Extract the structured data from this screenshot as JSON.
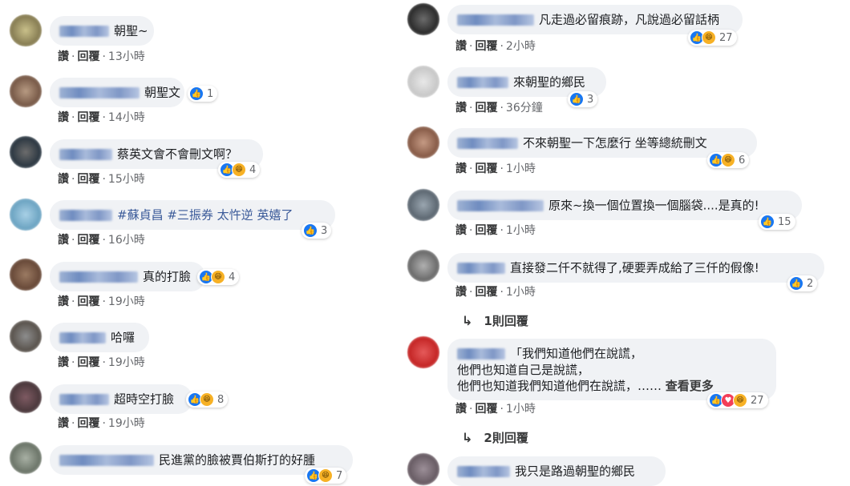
{
  "colors": {
    "like": "#1877f2",
    "haha": "#f7b125",
    "love": "#f33e58",
    "bubble": "#f0f2f5"
  },
  "labels": {
    "like": "讚",
    "reply": "回覆",
    "sep": "·"
  },
  "left_comments": [
    {
      "text": "朝聖~",
      "time": "13小時",
      "reactions": [],
      "count": ""
    },
    {
      "text": "朝聖文",
      "time": "14小時",
      "reactions": [
        "like"
      ],
      "count": "1"
    },
    {
      "text": "蔡英文會不會刪文啊？",
      "time": "15小時",
      "reactions": [
        "like",
        "haha"
      ],
      "count": "4"
    },
    {
      "text": "#蘇貞昌 #三振券 太忤逆 英嬉了",
      "time": "16小時",
      "reactions": [
        "like"
      ],
      "count": "3"
    },
    {
      "text": "真的打臉",
      "time": "19小時",
      "reactions": [
        "like",
        "haha"
      ],
      "count": "4"
    },
    {
      "text": "哈囉",
      "time": "19小時",
      "reactions": [],
      "count": ""
    },
    {
      "text": "超時空打臉",
      "time": "19小時",
      "reactions": [
        "like",
        "haha"
      ],
      "count": "8"
    },
    {
      "text": "民進黨的臉被賈伯斯打的好腫",
      "time": "",
      "reactions": [
        "like",
        "haha"
      ],
      "count": "7"
    }
  ],
  "right_comments": [
    {
      "text": "凡走過必留痕跡，凡說過必留話柄",
      "time": "2小時",
      "reactions": [
        "like",
        "haha"
      ],
      "count": "27"
    },
    {
      "text": "來朝聖的鄉民",
      "time": "36分鐘",
      "reactions": [
        "like"
      ],
      "count": "3"
    },
    {
      "text": "不來朝聖一下怎麼行 坐等總統刪文",
      "time": "1小時",
      "reactions": [
        "like",
        "haha"
      ],
      "count": "6"
    },
    {
      "text": "原來~換一個位置換一個腦袋....是真的!",
      "time": "1小時",
      "reactions": [
        "like"
      ],
      "count": "15"
    },
    {
      "text": "直接發二仟不就得了,硬要弄成給了三仟的假像!",
      "time": "1小時",
      "reactions": [
        "like"
      ],
      "count": "2"
    },
    {
      "text_lines": [
        "「我們知道他們在說謊，",
        "他們也知道自己是說謊，",
        "他們也知道我們知道他們在說謊，"
      ],
      "ellipsis": "……",
      "see_more": "查看更多",
      "time": "1小時",
      "reactions": [
        "like",
        "love",
        "haha"
      ],
      "count": "27"
    },
    {
      "text": "我只是路過朝聖的鄉民",
      "time": "",
      "reactions": [],
      "count": ""
    }
  ],
  "reply_links": [
    "1則回覆",
    "2則回覆"
  ]
}
